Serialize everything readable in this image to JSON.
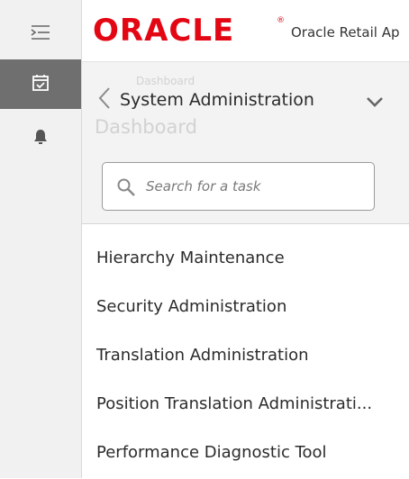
{
  "header": {
    "logo_text": "ORACLE",
    "registered_mark": "®",
    "app_title": "Oracle Retail Ap"
  },
  "rail": {
    "items": [
      {
        "icon": "menu-icon"
      },
      {
        "icon": "tasks-icon",
        "active": true
      },
      {
        "icon": "bell-icon"
      }
    ]
  },
  "panel": {
    "ghost_small": "Dashboard",
    "ghost_large": "Dashboard",
    "title": "System Administration",
    "search": {
      "placeholder": "Search for a task",
      "value": ""
    },
    "tasks": [
      {
        "label": "Hierarchy Maintenance"
      },
      {
        "label": "Security Administration"
      },
      {
        "label": "Translation Administration"
      },
      {
        "label": "Position Translation Administrati..."
      },
      {
        "label": "Performance Diagnostic Tool"
      }
    ]
  },
  "colors": {
    "brand_red": "#e30613",
    "rail_bg": "#f1f1f1",
    "rail_active": "#6f6f6f",
    "panel_bg": "#f3f3f3"
  }
}
